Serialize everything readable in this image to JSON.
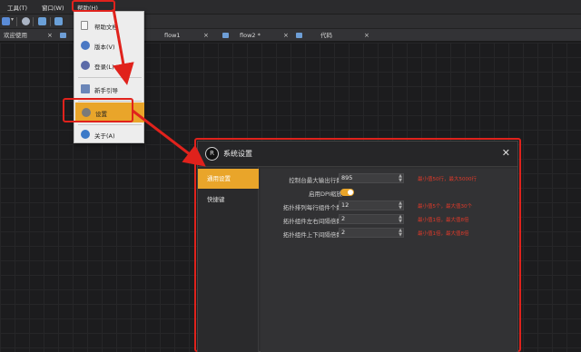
{
  "menubar": {
    "tools": "工具(T)",
    "window": "窗口(W)",
    "help": "帮助(H)"
  },
  "tabs": [
    {
      "label": "欢迎使用",
      "close": "×"
    },
    {
      "label": "flow1",
      "close": "×"
    },
    {
      "label": "flow2 *",
      "close": "×"
    },
    {
      "label": "代码",
      "close": "×"
    }
  ],
  "help_menu": {
    "items": [
      {
        "label": "帮助文档",
        "icon": "document-icon"
      },
      {
        "label": "版本(V)",
        "icon": "version-icon"
      },
      {
        "label": "登录(L)",
        "icon": "login-icon"
      },
      {
        "label": "新手引导",
        "icon": "guide-icon"
      },
      {
        "label": "设置",
        "icon": "settings-icon"
      },
      {
        "label": "关于(A)",
        "icon": "info-icon"
      }
    ]
  },
  "dialog": {
    "title": "系统设置",
    "close": "✕",
    "logo": "R",
    "sidebar": [
      "通用设置",
      "快捷键"
    ],
    "settings": [
      {
        "label": "控制台最大输出行数:",
        "value": "895",
        "hint": "最小值50行，最大5000行"
      },
      {
        "label": "启用DPI缩放:",
        "toggle": true
      },
      {
        "label": "拓扑排列每行组件个数:",
        "value": "12",
        "hint": "最小值5个，最大值30个"
      },
      {
        "label": "拓扑组件左右间隔倍数:",
        "value": "2",
        "hint": "最小值1倍，最大值8倍"
      },
      {
        "label": "拓扑组件上下间隔倍数:",
        "value": "2",
        "hint": "最小值1倍，最大值8倍"
      }
    ]
  },
  "colors": {
    "accent": "#e9a52a",
    "annotation_red": "#e0221c",
    "hint_red": "#e03a2a"
  }
}
